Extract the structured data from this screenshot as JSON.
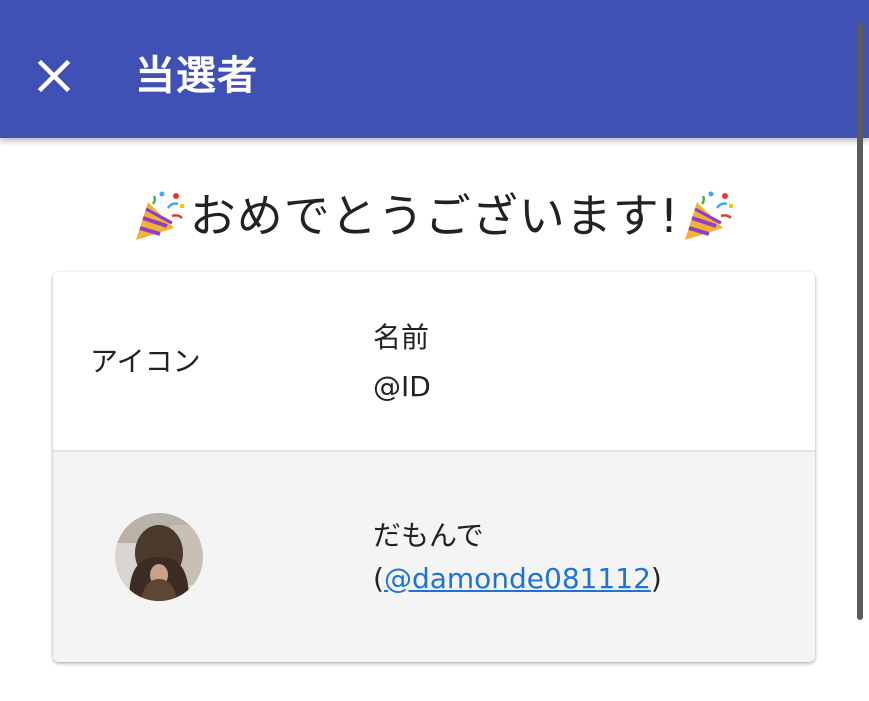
{
  "app_bar": {
    "close_icon": "close-icon",
    "title": "当選者",
    "background_color": "#3F51B5"
  },
  "congrats": {
    "leading_emoji": "party-popper-icon",
    "text": "おめでとうございます!",
    "trailing_emoji": "party-popper-icon"
  },
  "table": {
    "headers": {
      "icon": "アイコン",
      "name": "名前",
      "id": "@ID"
    },
    "rows": [
      {
        "avatar": "avatar-photo",
        "name": "だもんで",
        "id_open": "(",
        "id_link": "@damonde081112",
        "id_close": ")"
      }
    ]
  },
  "colors": {
    "link": "#1E73D6",
    "row_background": "#F4F4F4"
  }
}
